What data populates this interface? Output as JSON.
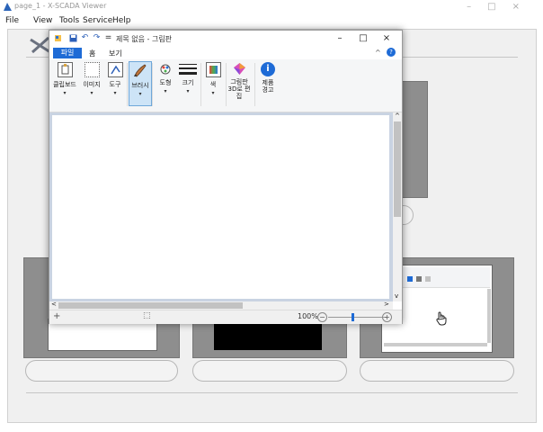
{
  "viewer": {
    "title": "page_1 - X-SCADA Viewer",
    "menu": [
      "File",
      "View",
      "Tools",
      "Service",
      "Help"
    ],
    "window_controls": {
      "minimize": "–",
      "maximize": "□",
      "close": "×"
    }
  },
  "paint": {
    "title": "제목 없음 - 그림판",
    "quick_access": {
      "undo": "↶",
      "redo": "↷",
      "customize": "="
    },
    "window_controls": {
      "minimize": "–",
      "maximize": "□",
      "close": "×"
    },
    "tabs": {
      "file": "파일",
      "home": "홈",
      "view": "보기"
    },
    "ribbon_collapse": "^",
    "help": "?",
    "ribbon": [
      {
        "label": "클립보드",
        "icon": "clipboard-icon"
      },
      {
        "label": "이미지",
        "icon": "image-icon"
      },
      {
        "label": "도구",
        "icon": "tools-icon"
      },
      {
        "label": "브러시",
        "icon": "brush-icon"
      },
      {
        "label": "도형",
        "icon": "shapes-icon"
      },
      {
        "label": "크기",
        "icon": "size-icon"
      },
      {
        "label": "색",
        "icon": "color-icon"
      },
      {
        "label": "그림판 3D로 편집",
        "icon": "paint3d-icon"
      },
      {
        "label": "제품 경고",
        "icon": "info-icon"
      }
    ],
    "ribbon_arrow": "▾",
    "scroll": {
      "up": "^",
      "down": "v",
      "left": "<",
      "right": ">"
    },
    "status": {
      "cursor": "+",
      "selection": "⬚",
      "zoom": "100%",
      "zoom_out": "−",
      "zoom_in": "+"
    }
  },
  "colors": {
    "accent": "#1e6bd6",
    "thumb_frame": "#8e8e8e",
    "info": "#1e6bd6"
  }
}
